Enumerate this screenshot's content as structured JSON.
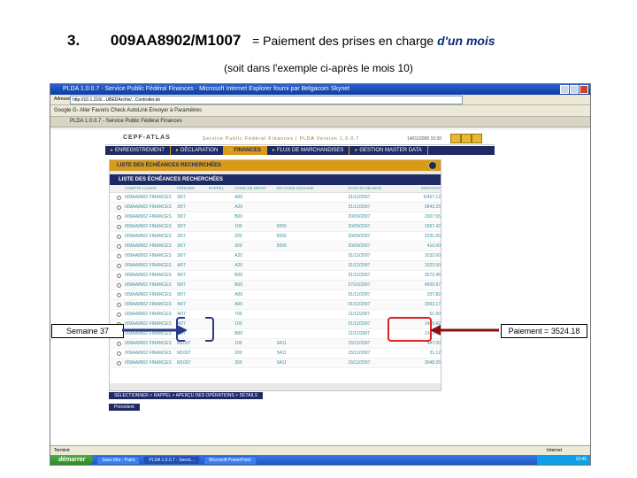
{
  "heading": {
    "number": "3.",
    "code": "009AA8902/M1007",
    "desc_prefix": "= Paiement des prises en charge",
    "desc_highlight": "d'un mois",
    "subtitle": "(soit dans l'exemple ci-après le mois 10)"
  },
  "browser": {
    "title": "PLDA 1.0.0.7 - Service Public Fédéral Finances - Microsoft Internet Explorer fourni par Belgacom Skynet",
    "address_label": "Adresse",
    "url": "http://10.1.216/...UBEDArchiv/...Controller.do",
    "toolbar": "Google  G-   Aller  Favoris  Check  AutoLink  Envoyer à  Paramètres",
    "tab_label": "PLDA 1.0.0.7 - Service Public Fédéral Finances",
    "status_left": "Terminé",
    "status_right": "Internet"
  },
  "app": {
    "logo": "CEPF-ATLAS",
    "version": "Service Public Fédéral Finances | PLDA Version 1.0.0.7",
    "user": "14/01/2008  10:30",
    "nav_tabs": [
      {
        "label": "ENREGISTREMENT"
      },
      {
        "label": "DÉCLARATION"
      },
      {
        "label": "FINANCES"
      },
      {
        "label": "FLUX DE MARCHANDISES"
      },
      {
        "label": "GESTION MASTER DATA"
      }
    ],
    "panel_title": "LISTE DES ÉCHÉANCES RECHERCHÉES",
    "list_title": "LISTE DES ÉCHÉANCES RECHERCHÉES",
    "columns": [
      "COMPTE CLIENT",
      "PÉRIODE",
      "RAPPEL",
      "CODE DE DROIT",
      "N/A CODE DOUANE",
      "DATE ÉCHÉANCE",
      "MONTANT"
    ],
    "rows": [
      [
        "009AA8902 FINANCES",
        "3/07",
        "",
        "A00",
        "",
        "31/12/2007",
        "5/467.12"
      ],
      [
        "009AA8902 FINANCES",
        "3/07",
        "",
        "A20",
        "",
        "31/12/2007",
        "2843.25"
      ],
      [
        "009AA8902 FINANCES",
        "3/07",
        "",
        "B00",
        "",
        "20/09/2007",
        "2307.55"
      ],
      [
        "009AA8902 FINANCES",
        "3/07",
        "",
        "100",
        "5000",
        "20/09/2007",
        "1067.42"
      ],
      [
        "009AA8902 FINANCES",
        "3/07",
        "",
        "200",
        "5000",
        "20/09/2007",
        "2331.00"
      ],
      [
        "009AA8902 FINANCES",
        "3/07",
        "",
        "300",
        "5000",
        "20/09/2007",
        "410.00"
      ],
      [
        "009AA8902 FINANCES",
        "3/07",
        "",
        "A20",
        "",
        "31/12/2007",
        "1032.60"
      ],
      [
        "009AA8902 FINANCES",
        "4/07",
        "",
        "A20",
        "",
        "31/12/2007",
        "1023.50"
      ],
      [
        "009AA8902 FINANCES",
        "4/07",
        "",
        "B00",
        "",
        "31/12/2007",
        "3072.46"
      ],
      [
        "009AA8902 FINANCES",
        "9/07",
        "",
        "B00",
        "",
        "27/10/2007",
        "4500.97"
      ],
      [
        "009AA8902 FINANCES",
        "9/07",
        "",
        "A00",
        "",
        "01/12/2007",
        "337.82"
      ],
      [
        "009AA8902 FINANCES",
        "4/07",
        "",
        "A00",
        "",
        "01/12/2007",
        "2063.17"
      ],
      [
        "009AA8902 FINANCES",
        "4/07",
        "",
        "700",
        "",
        "11/12/2007",
        "51.00"
      ],
      [
        "009AA8902 FINANCES",
        "4/07",
        "",
        "100",
        "",
        "01/12/2007",
        "1499.42"
      ],
      [
        "009AA8902 FINANCES",
        "4/07",
        "",
        "B00",
        "",
        "11/12/2007",
        "1163.72"
      ],
      [
        "009AA8902 FINANCES",
        "M1007",
        "",
        "100",
        "S411",
        "15/12/2007",
        "447.00"
      ],
      [
        "009AA8902 FINANCES",
        "M1007",
        "",
        "200",
        "S411",
        "15/12/2007",
        "31.12"
      ],
      [
        "009AA8902 FINANCES",
        "M1007",
        "",
        "300",
        "S411",
        "15/12/2007",
        "3048.26"
      ]
    ],
    "footer_links": "SÉLECTIONNER  >  RAPPEL  >  APERÇU DES OPÉRATIONS  >  DÉTAILS",
    "back_button": "Précédent"
  },
  "taskbar": {
    "start": "démarrer",
    "tasks": [
      "Sans titre - Paint",
      "PLDA 1.0.0.7 - Servic...",
      "Microsoft PowerPoint"
    ],
    "clock": "10:45"
  },
  "annotations": {
    "left": "Semaine 37",
    "right": "Paiement = 3524.18"
  }
}
